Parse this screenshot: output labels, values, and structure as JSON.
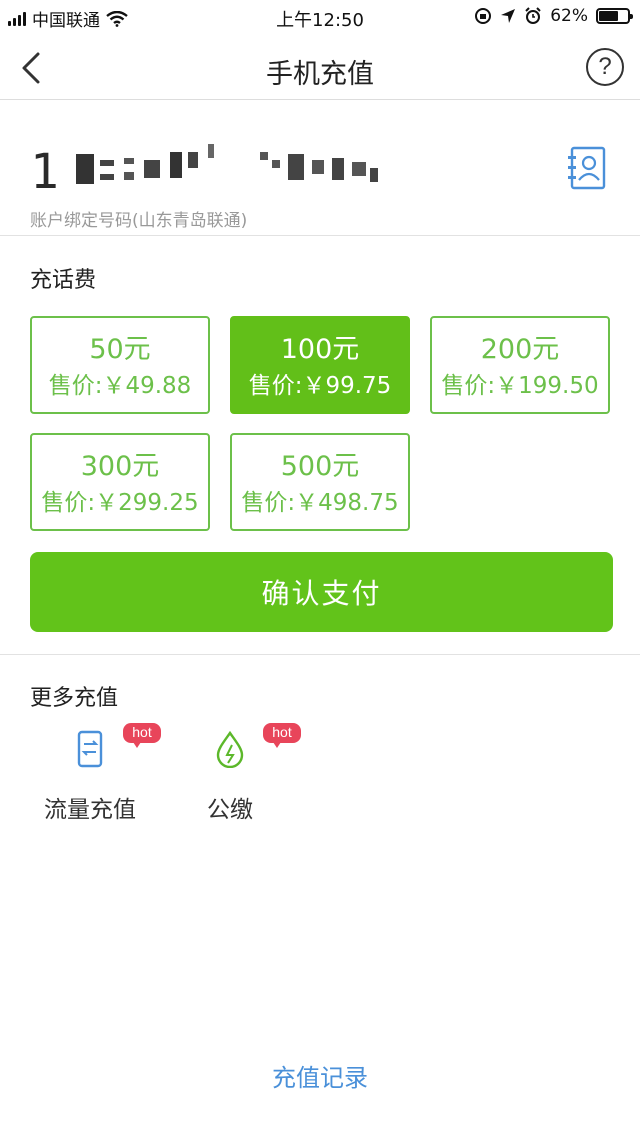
{
  "status_bar": {
    "carrier": "中国联通",
    "time": "上午12:50",
    "battery_percent": "62%",
    "battery_level": 0.62
  },
  "nav": {
    "title": "手机充值",
    "help_symbol": "?"
  },
  "account": {
    "phone_visible_prefix": "1",
    "label": "账户绑定号码(山东青岛联通)"
  },
  "recharge": {
    "section_title": "充话费",
    "options": [
      {
        "amount": "50元",
        "price": "售价:￥49.88",
        "selected": false
      },
      {
        "amount": "100元",
        "price": "售价:￥99.75",
        "selected": true
      },
      {
        "amount": "200元",
        "price": "售价:￥199.50",
        "selected": false
      },
      {
        "amount": "300元",
        "price": "售价:￥299.25",
        "selected": false
      },
      {
        "amount": "500元",
        "price": "售价:￥498.75",
        "selected": false
      }
    ],
    "pay_button": "确认支付"
  },
  "more": {
    "section_title": "更多充值",
    "items": [
      {
        "label": "流量充值",
        "badge": "hot",
        "icon": "phone-data-icon"
      },
      {
        "label": "公缴",
        "badge": "hot",
        "icon": "utility-drop-icon"
      }
    ]
  },
  "footer": {
    "history_link": "充值记录"
  },
  "colors": {
    "accent_green": "#62bf19",
    "hot_red": "#e8455a",
    "link_blue": "#4a90d9"
  }
}
